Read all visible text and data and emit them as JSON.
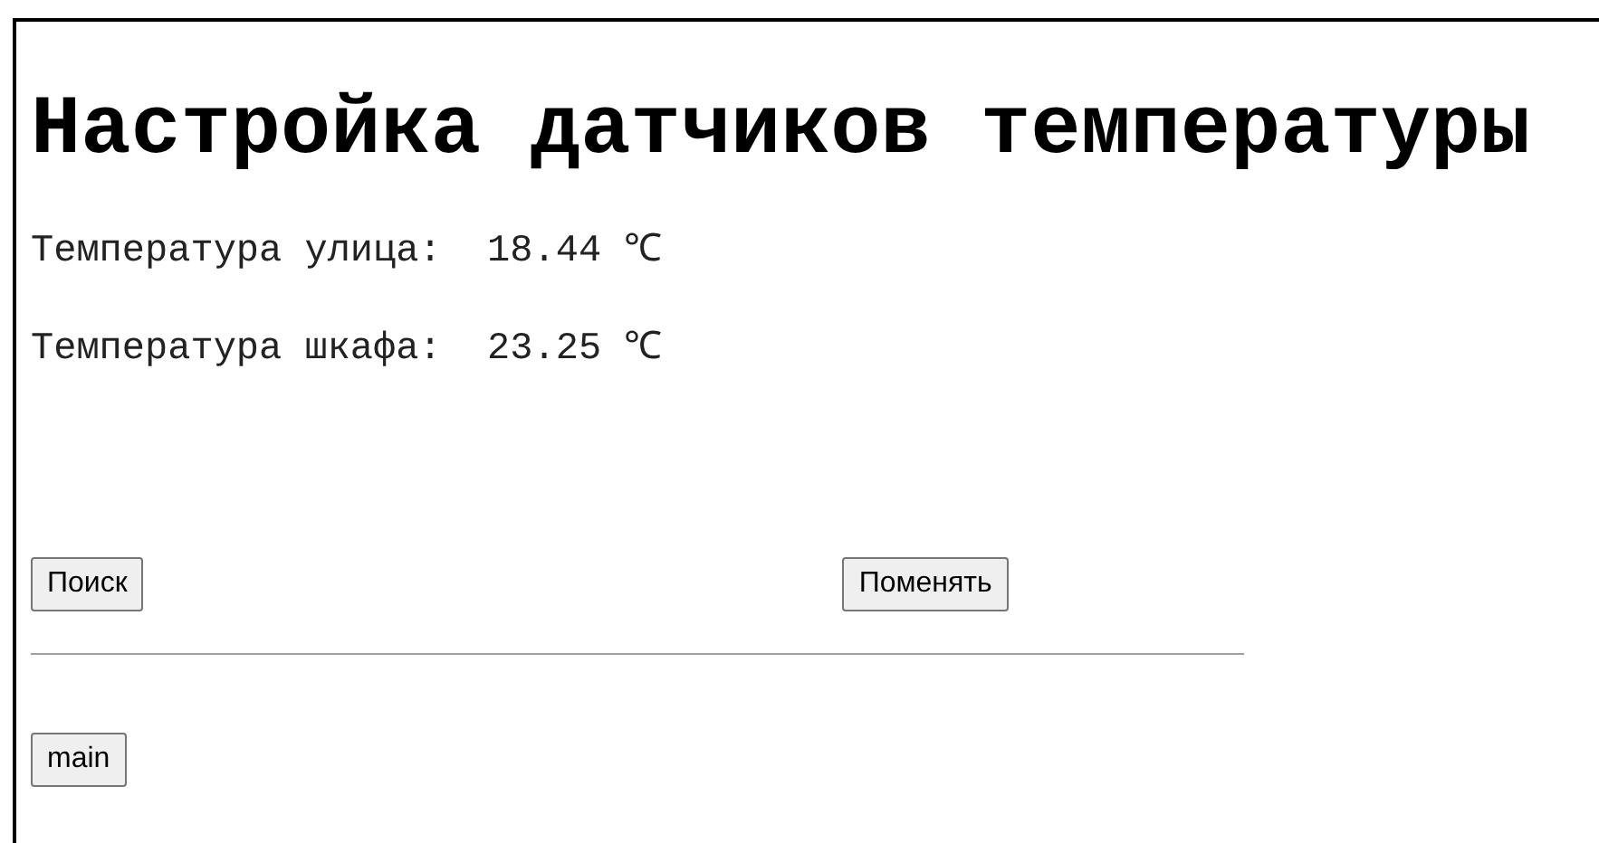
{
  "title": "Настройка датчиков температуры",
  "readings": [
    {
      "label": "Температура улица:",
      "value": "18.44 ℃"
    },
    {
      "label": "Температура шкафа:",
      "value": "23.25 ℃"
    }
  ],
  "buttons": [
    "Поиск",
    "Поменять"
  ],
  "footer_button": "main"
}
